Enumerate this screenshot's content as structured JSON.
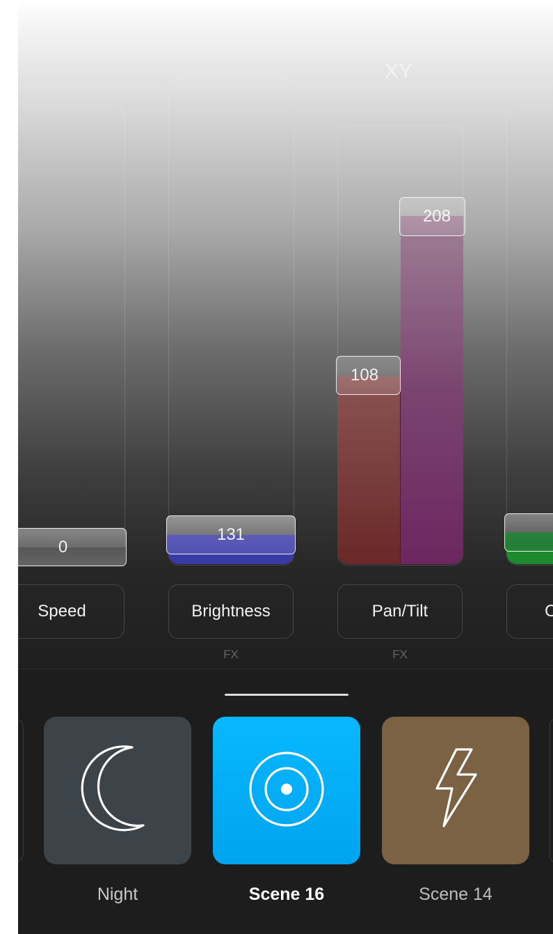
{
  "group_label": "XY",
  "faders": {
    "speed": {
      "value": "0",
      "label": "Speed"
    },
    "brightness": {
      "value": "131",
      "label": "Brightness",
      "fx": "FX"
    },
    "pan_tilt": {
      "pan_value": "108",
      "tilt_value": "208",
      "label": "Pan/Tilt",
      "fx": "FX"
    },
    "partial": {
      "label": "C"
    }
  },
  "scenes": [
    {
      "label": "Night",
      "icon": "moon-icon",
      "color": "#3d4449"
    },
    {
      "label": "Scene 16",
      "icon": "target-icon",
      "color": "#00aaf2",
      "selected": true
    },
    {
      "label": "Scene 14",
      "icon": "lightning-icon",
      "color": "#7a6243"
    }
  ]
}
